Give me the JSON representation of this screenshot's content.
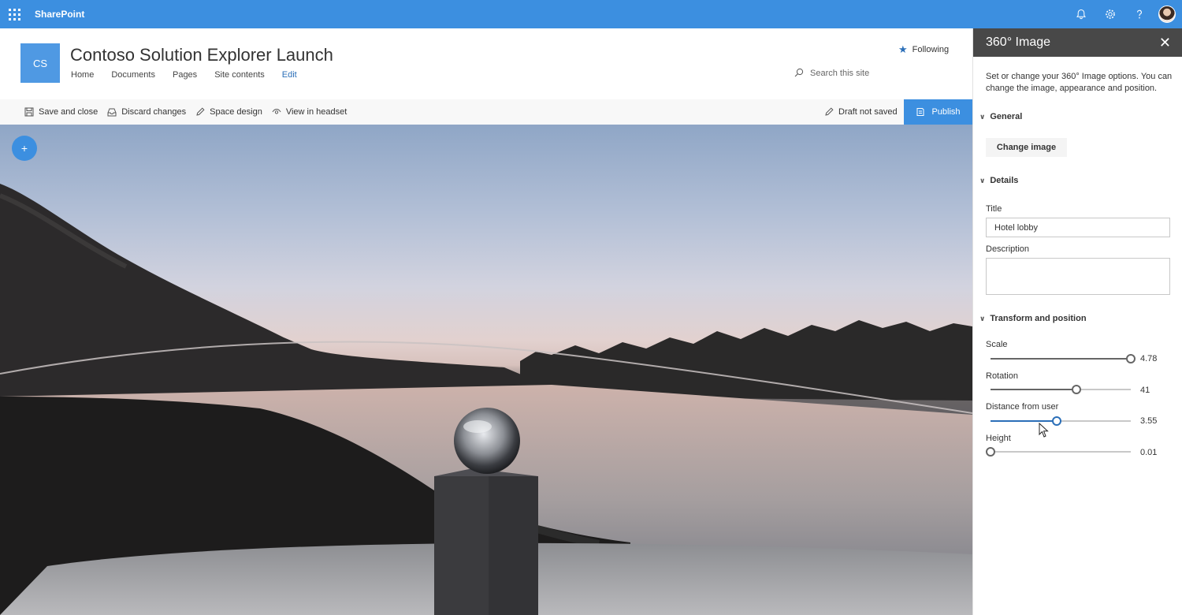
{
  "suite": {
    "app_name": "SharePoint",
    "icons": [
      "waffle-icon",
      "bell-icon",
      "gear-icon",
      "help-icon",
      "avatar"
    ]
  },
  "site": {
    "logo_initials": "CS",
    "title": "Contoso Solution Explorer Launch",
    "nav": [
      "Home",
      "Documents",
      "Pages",
      "Site contents",
      "Edit"
    ],
    "following_label": "Following",
    "search_placeholder": "Search this site"
  },
  "commandbar": {
    "save_close": "Save and close",
    "discard": "Discard changes",
    "space_design": "Space design",
    "view_headset": "View in headset",
    "draft_status": "Draft not saved",
    "publish": "Publish"
  },
  "canvas": {
    "add_label": "+"
  },
  "pane": {
    "title": "360° Image",
    "description": "Set or change your 360° Image options. You can change the image, appearance and position.",
    "general_heading": "General",
    "change_image": "Change image",
    "details_heading": "Details",
    "title_label": "Title",
    "title_value": "Hotel lobby",
    "description_label": "Description",
    "description_value": "",
    "transform_heading": "Transform and position",
    "sliders": [
      {
        "label": "Scale",
        "value": "4.78",
        "fraction": 1.0
      },
      {
        "label": "Rotation",
        "value": "41",
        "fraction": 0.61
      },
      {
        "label": "Distance from user",
        "value": "3.55",
        "fraction": 0.47
      },
      {
        "label": "Height",
        "value": "0.01",
        "fraction": 0.0
      }
    ]
  },
  "colors": {
    "brand": "#3c8fe0",
    "pane_header": "#484848",
    "active_slider": "#2b6fb8"
  }
}
